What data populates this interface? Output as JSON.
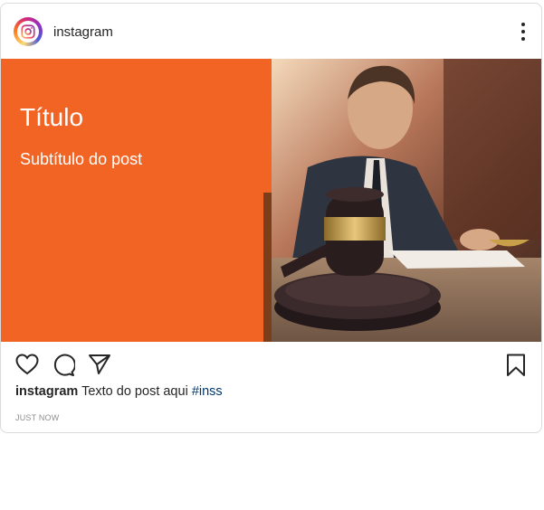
{
  "header": {
    "username": "instagram",
    "more_icon": "more-vertical-icon",
    "avatar_icon": "instagram-logo-icon"
  },
  "post": {
    "title": "Título",
    "subtitle": "Subtítulo do post",
    "image_description_icon": "judge-gavel-photo",
    "background_color": "#f26424"
  },
  "actions": {
    "like_icon": "heart-icon",
    "comment_icon": "comment-icon",
    "share_icon": "send-icon",
    "save_icon": "bookmark-icon"
  },
  "caption": {
    "username": "instagram",
    "text": "Texto do post aqui",
    "hashtag": "#inss"
  },
  "timestamp": "JUST NOW"
}
